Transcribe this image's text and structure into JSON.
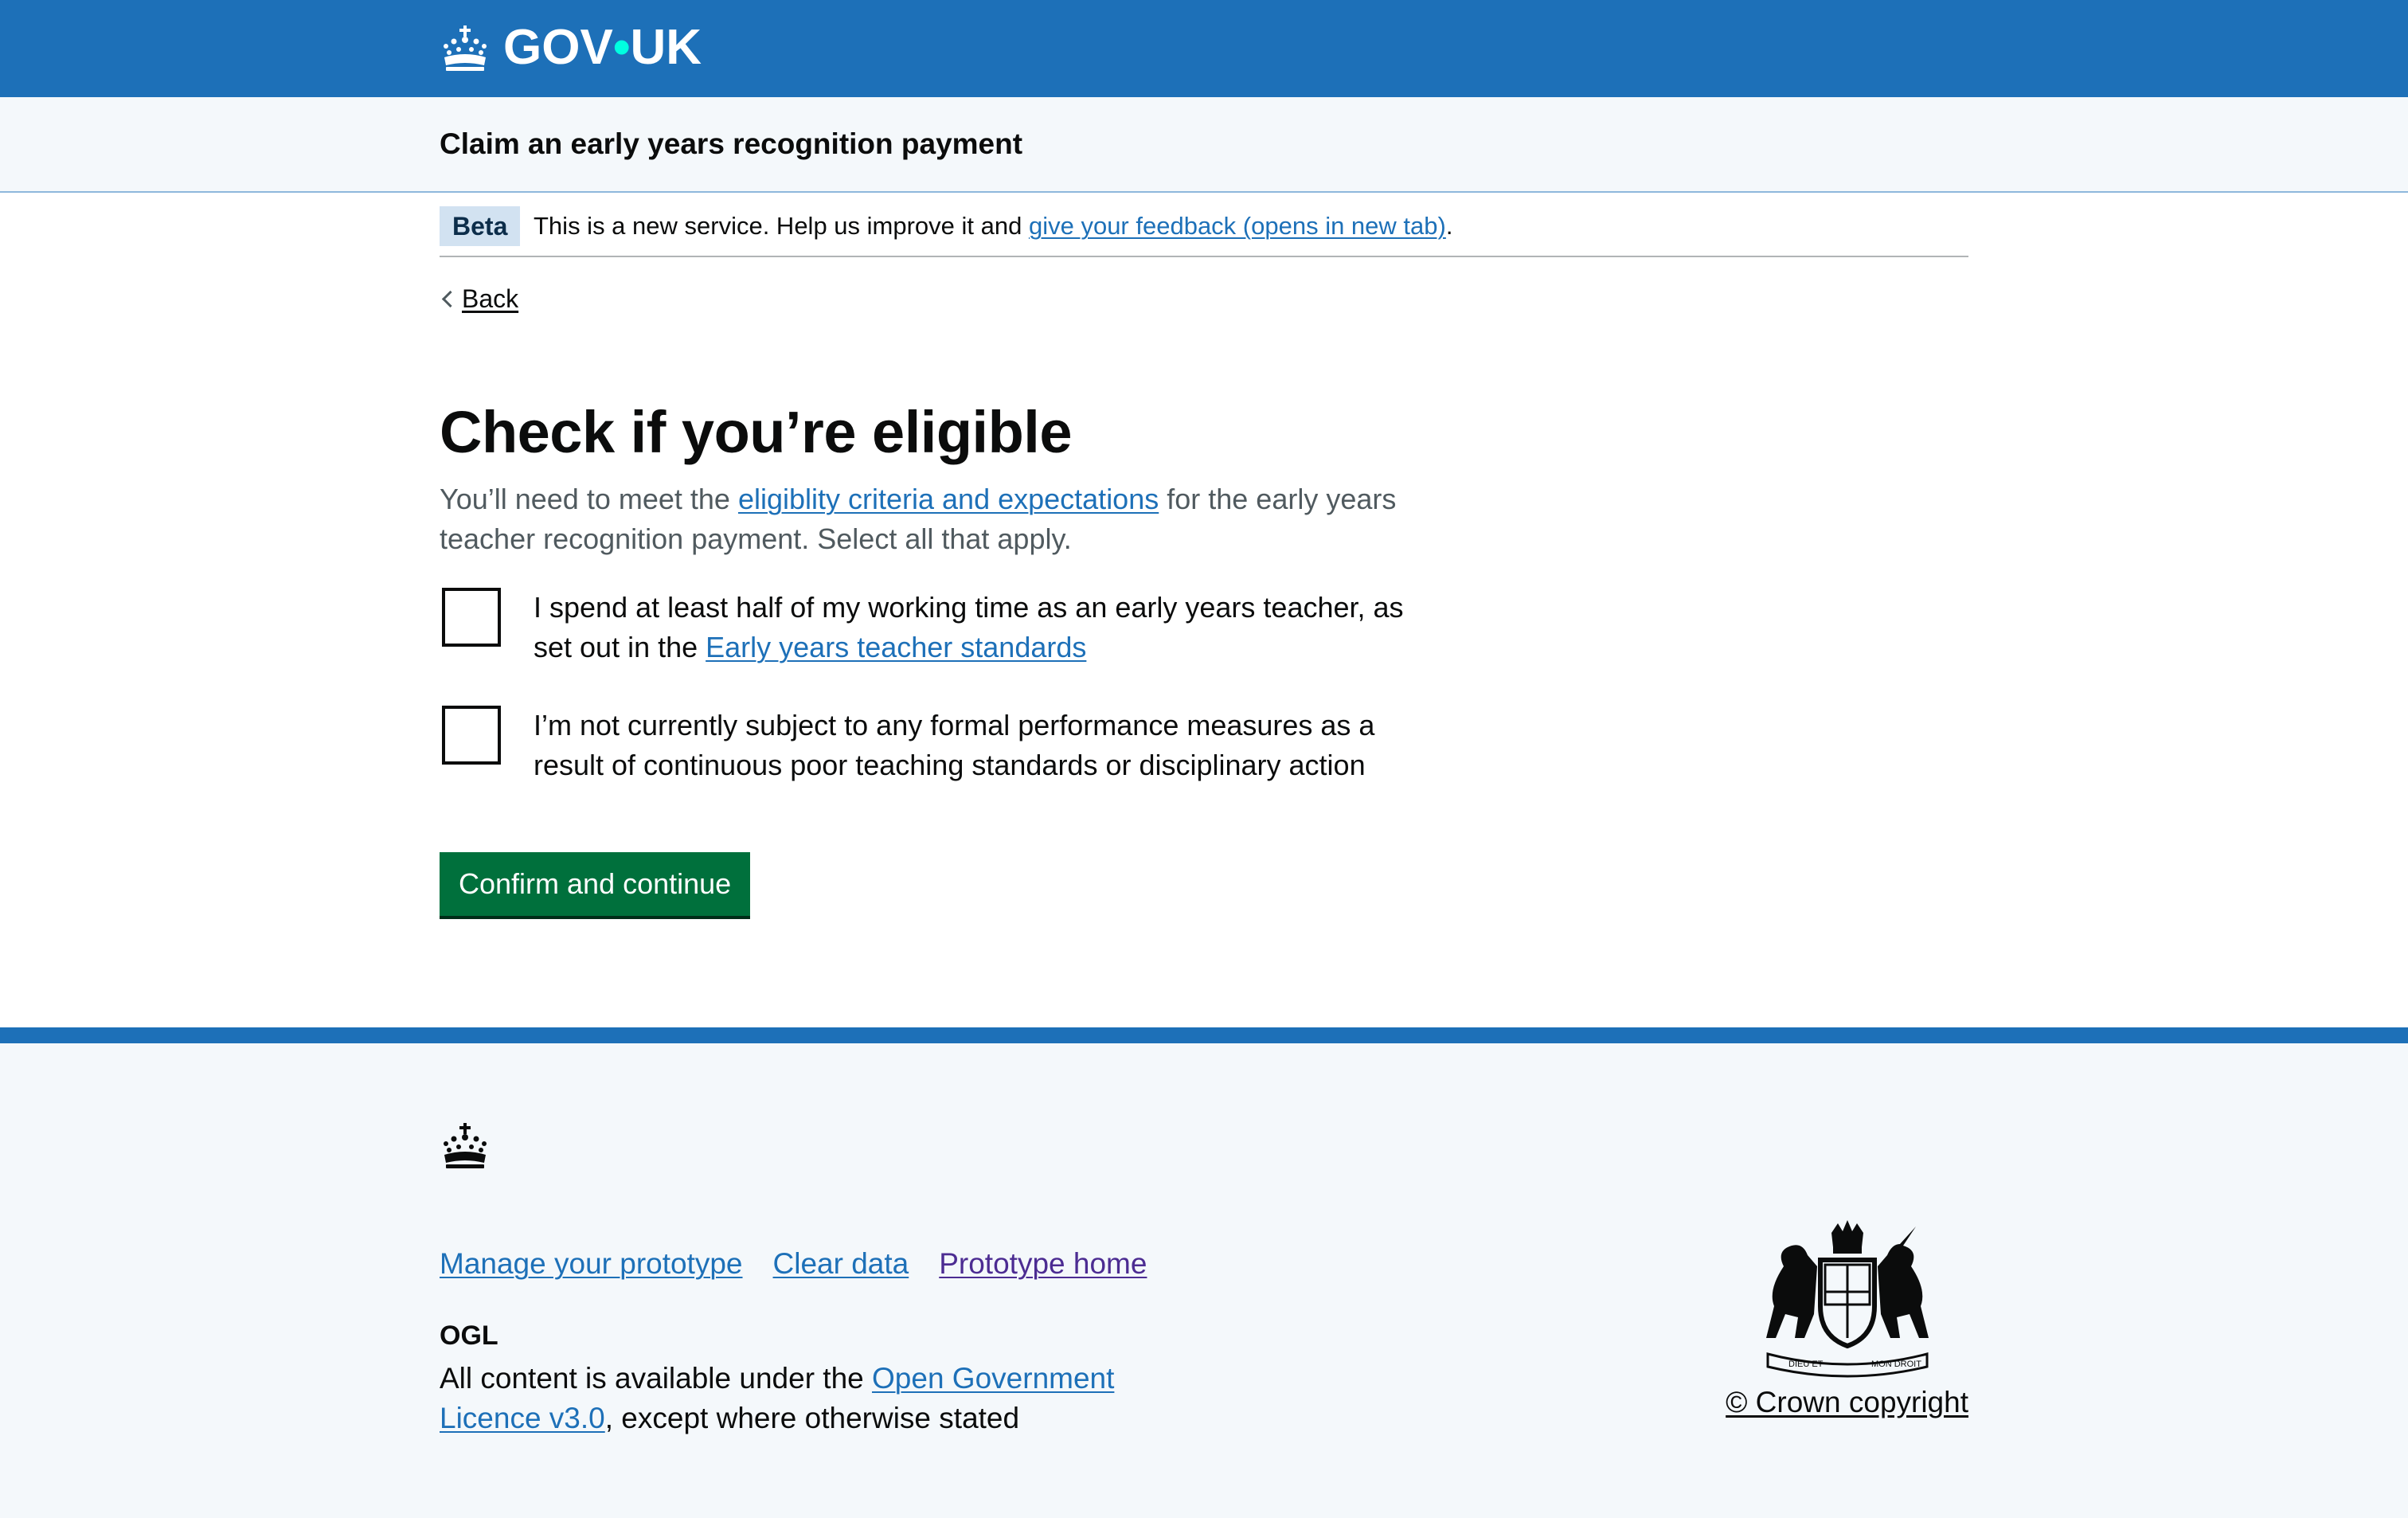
{
  "header": {
    "logo_text_left": "GOV",
    "logo_dot": "•",
    "logo_text_right": "UK",
    "service_name": "Claim an early years recognition payment"
  },
  "phase_banner": {
    "tag": "Beta",
    "text_before": "This is a new service. Help us improve it and ",
    "feedback_link": "give your feedback (opens in new tab)",
    "text_after": "."
  },
  "back_link": "Back",
  "main": {
    "title": "Check if you’re eligible",
    "hint_before": "You’ll need to meet the ",
    "hint_link": "eligiblity criteria and expectations",
    "hint_after": " for the early years teacher recognition payment. Select all that apply.",
    "checkboxes": [
      {
        "label_before": "I spend at least half of my working time as an early years teacher, as set out in the ",
        "label_link": "Early years teacher standards",
        "checked": false
      },
      {
        "label_before": "I’m not currently subject to any formal performance measures as a result of continuous poor teaching standards or disciplinary action",
        "checked": false
      }
    ],
    "button": "Confirm and continue"
  },
  "footer": {
    "links": [
      "Manage your prototype",
      "Clear data",
      "Prototype home"
    ],
    "licence_before": "All content is available under the ",
    "licence_link": "Open Government Licence v3.0",
    "licence_after": ", except where otherwise stated",
    "copyright": "© Crown copyright",
    "ogl_text": "OGL",
    "coat_text_left": "DIEU ET",
    "coat_text_right": "MON DROIT"
  },
  "colors": {
    "header_blue": "#1d70b8",
    "link_blue": "#1d70b8",
    "visited_purple": "#4c2c92",
    "button_green": "#00703c",
    "service_bar_bg": "#f4f8fb"
  }
}
